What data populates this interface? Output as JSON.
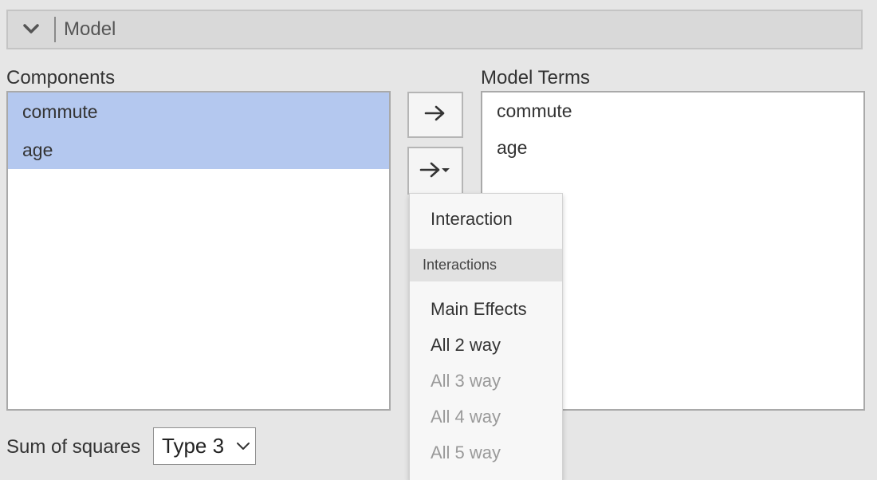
{
  "section": {
    "title": "Model"
  },
  "components": {
    "label": "Components",
    "items": [
      "commute",
      "age"
    ]
  },
  "model_terms": {
    "label": "Model Terms",
    "items": [
      "commute",
      "age"
    ]
  },
  "interaction_menu": {
    "top_item": "Interaction",
    "group_header": "Interactions",
    "items": [
      {
        "label": "Main Effects",
        "enabled": true
      },
      {
        "label": "All 2 way",
        "enabled": true
      },
      {
        "label": "All 3 way",
        "enabled": false
      },
      {
        "label": "All 4 way",
        "enabled": false
      },
      {
        "label": "All 5 way",
        "enabled": false
      }
    ]
  },
  "sum_of_squares": {
    "label": "Sum of squares",
    "selected": "Type 3"
  },
  "icons": {
    "collapse": "chevron-down-icon",
    "add": "arrow-right-icon",
    "add_menu": "arrow-right-dropdown-icon"
  },
  "colors": {
    "selection": "#b4c8ef"
  }
}
